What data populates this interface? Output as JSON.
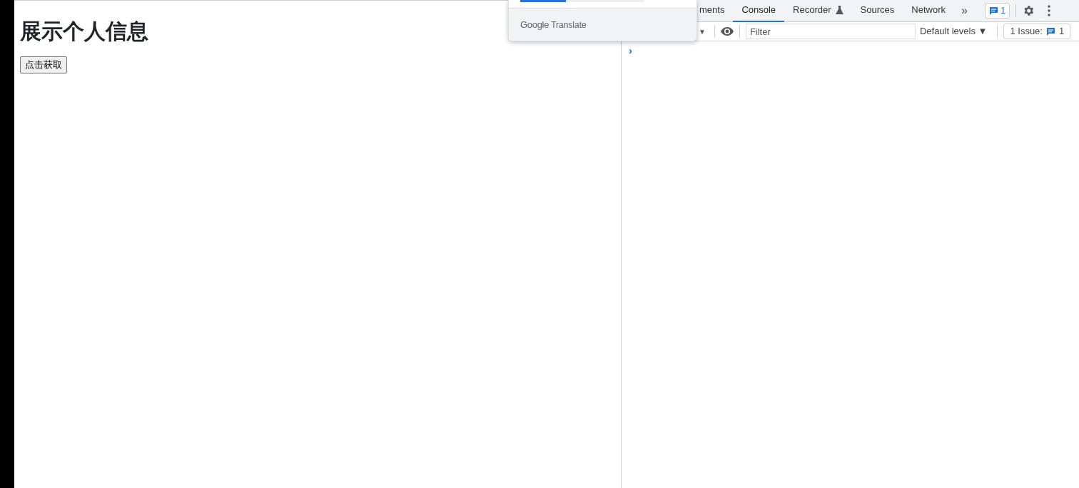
{
  "page": {
    "heading": "展示个人信息",
    "button": "点击获取"
  },
  "devtools": {
    "tabs": [
      {
        "label": "ments",
        "selected": false,
        "kind": "text"
      },
      {
        "label": "Console",
        "selected": true,
        "kind": "text"
      },
      {
        "label": "Recorder",
        "selected": false,
        "kind": "flask"
      },
      {
        "label": "Sources",
        "selected": false,
        "kind": "text"
      },
      {
        "label": "Network",
        "selected": false,
        "kind": "text"
      }
    ],
    "more_tabs": "»",
    "issues_badge": "1",
    "toolbar": {
      "dropdown_caret": "▼",
      "filter_placeholder": "Filter",
      "levels": "Default levels",
      "levels_caret": "▼",
      "issues_label": "1 Issue:",
      "issues_count": "1"
    },
    "prompt": "›"
  },
  "translate_popup": {
    "brand_google": "Google",
    "brand_translate": "Translate"
  }
}
